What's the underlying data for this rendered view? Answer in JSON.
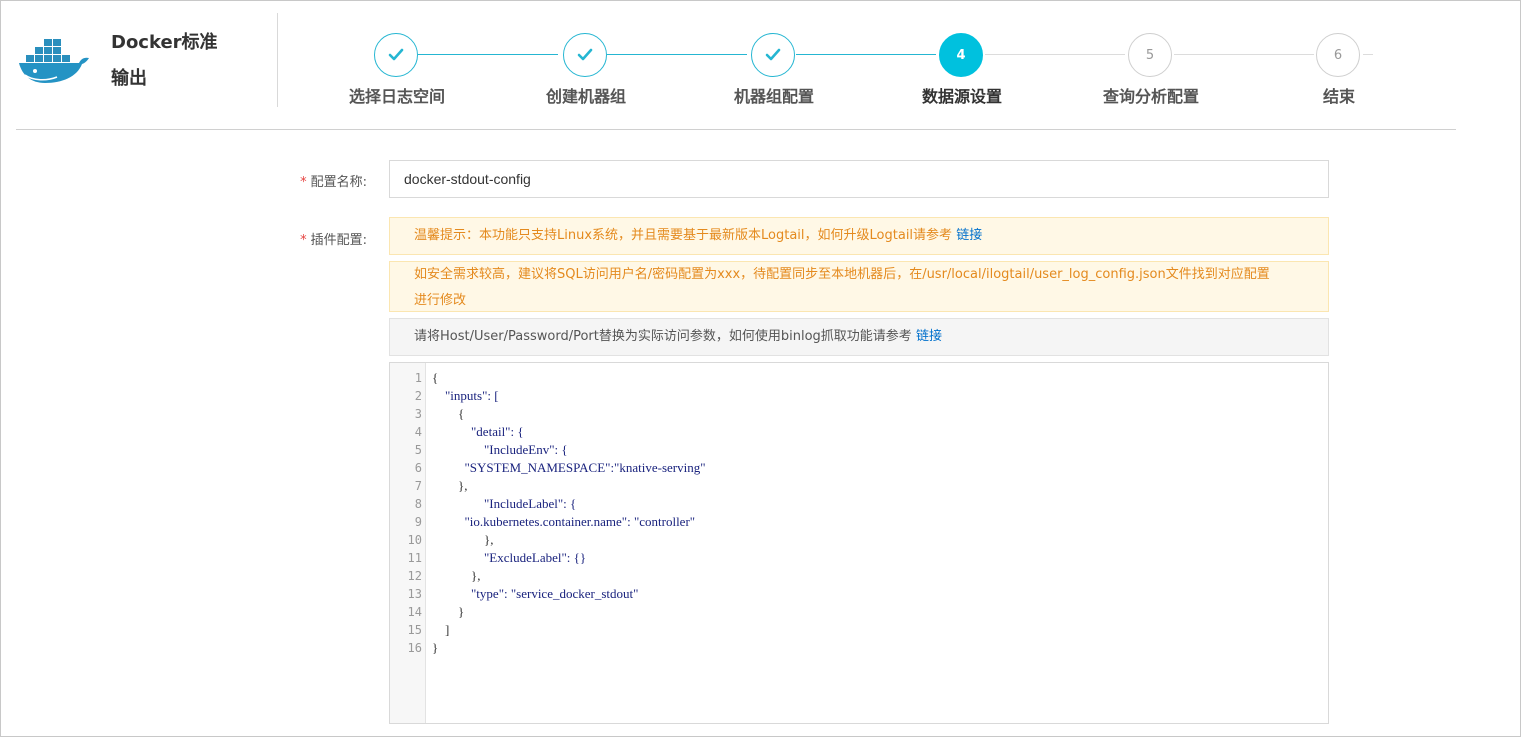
{
  "header": {
    "title_line1": "Docker标准",
    "title_line2": "输出",
    "logo_icon": "docker-whale-icon",
    "accent_color": "#00c1de"
  },
  "steps": [
    {
      "index": "1",
      "label": "选择日志空间",
      "state": "done"
    },
    {
      "index": "2",
      "label": "创建机器组",
      "state": "done"
    },
    {
      "index": "3",
      "label": "机器组配置",
      "state": "done"
    },
    {
      "index": "4",
      "label": "数据源设置",
      "state": "active"
    },
    {
      "index": "5",
      "label": "查询分析配置",
      "state": "todo"
    },
    {
      "index": "6",
      "label": "结束",
      "state": "todo"
    }
  ],
  "form": {
    "config_name_label": "配置名称:",
    "config_name_value": "docker-stdout-config",
    "plugin_label": "插件配置:",
    "required_mark": "*",
    "notice1_text": "温馨提示：本功能只支持Linux系统，并且需要基于最新版本Logtail，如何升级Logtail请参考",
    "notice1_link": "链接",
    "notice2_line1": "如安全需求较高，建议将SQL访问用户名/密码配置为xxx，待配置同步至本地机器后，在/usr/local/ilogtail/user_log_config.json文件找到对应配置",
    "notice2_line2": "进行修改",
    "notice3_text": "请将Host/User/Password/Port替换为实际访问参数，如何使用binlog抓取功能请参考",
    "notice3_link": "链接"
  },
  "editor": {
    "lines": [
      "{",
      "    \"inputs\": [",
      "        {",
      "            \"detail\": {",
      "                \"IncludeEnv\": {",
      "          \"SYSTEM_NAMESPACE\":\"knative-serving\"",
      "        },",
      "                \"IncludeLabel\": {",
      "          \"io.kubernetes.container.name\": \"controller\"",
      "                },",
      "                \"ExcludeLabel\": {}",
      "            },",
      "            \"type\": \"service_docker_stdout\"",
      "        }",
      "    ]",
      "}"
    ],
    "line_numbers": [
      "1",
      "2",
      "3",
      "4",
      "5",
      "6",
      "7",
      "8",
      "9",
      "10",
      "11",
      "12",
      "13",
      "14",
      "15",
      "16"
    ]
  }
}
